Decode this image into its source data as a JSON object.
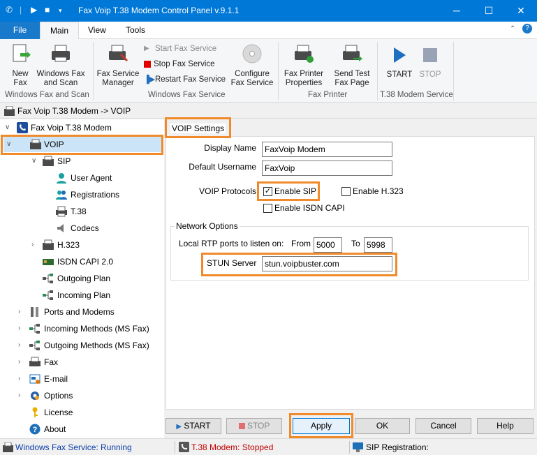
{
  "window": {
    "title": "Fax Voip T.38 Modem Control Panel v.9.1.1",
    "minimize": "─",
    "maximize": "☐",
    "close": "✕"
  },
  "ribbon_tabs": [
    "File",
    "Main",
    "View",
    "Tools"
  ],
  "ribbon": {
    "new_fax": "New\nFax",
    "windows_fax_scan": "Windows Fax\nand Scan",
    "group_wfs": "Windows Fax and Scan",
    "fax_service_manager": "Fax Service\nManager",
    "start_fax_service": "Start Fax Service",
    "stop_fax_service": "Stop Fax Service",
    "restart_fax_service": "Restart Fax Service",
    "configure_fax_service": "Configure\nFax Service",
    "group_ws": "Windows Fax Service",
    "fax_printer_properties": "Fax Printer\nProperties",
    "send_test_fax_page": "Send Test\nFax Page",
    "group_fp": "Fax Printer",
    "start": "START",
    "stop": "STOP",
    "group_t38": "T.38 Modem Service"
  },
  "breadcrumb": "Fax Voip T.38 Modem -> VOIP",
  "tree": [
    {
      "label": "Fax Voip T.38 Modem",
      "icon": "phone-icon"
    },
    {
      "label": "VOIP",
      "icon": "fax-icon"
    },
    {
      "label": "SIP",
      "icon": "fax-icon"
    },
    {
      "label": "User Agent",
      "icon": "user-icon"
    },
    {
      "label": "Registrations",
      "icon": "users-icon"
    },
    {
      "label": "T.38",
      "icon": "printer-icon"
    },
    {
      "label": "Codecs",
      "icon": "speaker-icon"
    },
    {
      "label": "H.323",
      "icon": "fax-icon"
    },
    {
      "label": "ISDN CAPI 2.0",
      "icon": "card-icon"
    },
    {
      "label": "Outgoing Plan",
      "icon": "network-icon"
    },
    {
      "label": "Incoming Plan",
      "icon": "network-icon"
    },
    {
      "label": "Ports and Modems",
      "icon": "ports-icon"
    },
    {
      "label": "Incoming Methods (MS Fax)",
      "icon": "network-icon"
    },
    {
      "label": "Outgoing Methods (MS Fax)",
      "icon": "network-icon"
    },
    {
      "label": "Fax",
      "icon": "fax-icon"
    },
    {
      "label": "E-mail",
      "icon": "email-icon"
    },
    {
      "label": "Options",
      "icon": "gear-icon"
    },
    {
      "label": "License",
      "icon": "key-icon"
    },
    {
      "label": "About",
      "icon": "info-icon"
    }
  ],
  "voip": {
    "section_title": "VOIP Settings",
    "display_name_label": "Display Name",
    "display_name_value": "FaxVoip Modem",
    "default_username_label": "Default Username",
    "default_username_value": "FaxVoip",
    "protocols_label": "VOIP Protocols",
    "enable_sip": "Enable SIP",
    "enable_h323": "Enable H.323",
    "enable_isdn": "Enable ISDN CAPI",
    "network_options": "Network Options",
    "rtp_label": "Local RTP ports to listen on:",
    "from_label": "From",
    "from_value": "5000",
    "to_label": "To",
    "to_value": "5998",
    "stun_label": "STUN Server",
    "stun_value": "stun.voipbuster.com"
  },
  "checks": {
    "sip": true,
    "h323": false,
    "isdn": false
  },
  "buttons": {
    "start": "START",
    "stop": "STOP",
    "apply": "Apply",
    "ok": "OK",
    "cancel": "Cancel",
    "help": "Help"
  },
  "status": {
    "windows_fax": "Windows Fax Service: Running",
    "t38_modem": "T.38 Modem: Stopped",
    "sip_registration": "SIP Registration:"
  },
  "colors": {
    "accent": "#0078d7",
    "highlight": "#f08a2a",
    "running": "#0a3ca8",
    "stopped": "#c00000"
  }
}
